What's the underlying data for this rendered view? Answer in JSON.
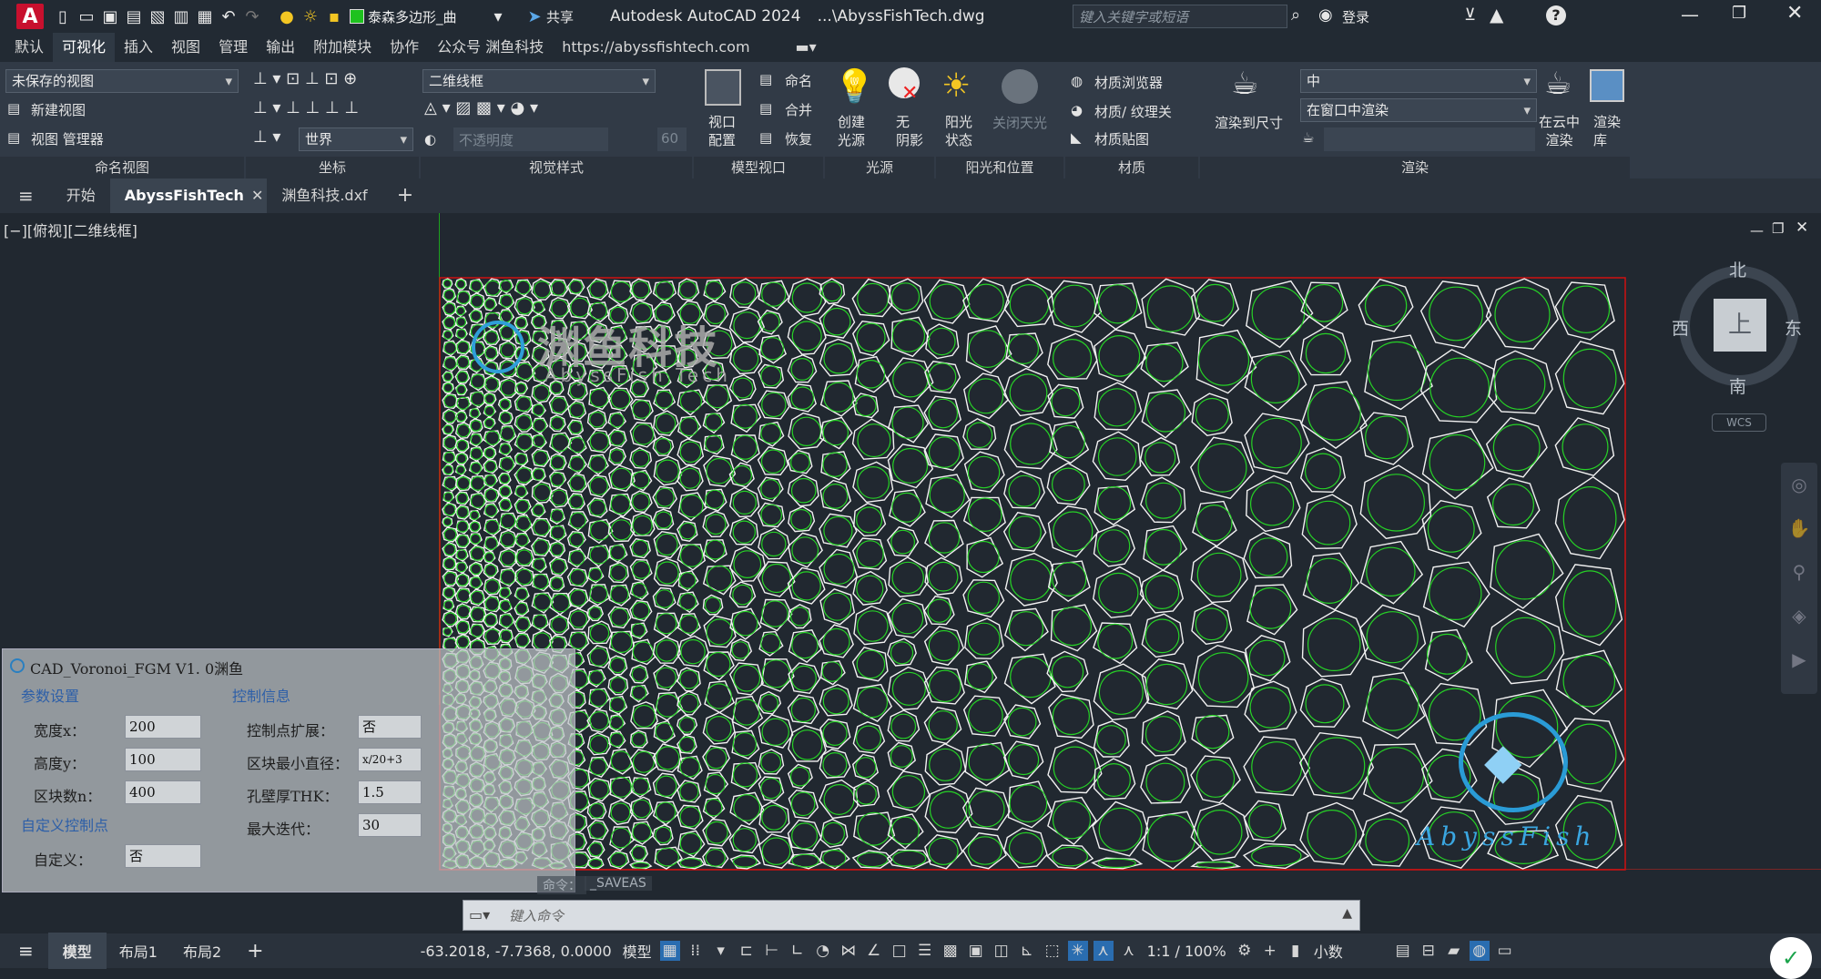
{
  "title": {
    "app_name": "Autodesk AutoCAD 2024",
    "file": "...\\AbyssFishTech.dwg",
    "layer": "泰森多边形_曲",
    "share": "共享",
    "search_placeholder": "键入关键字或短语",
    "login": "登录"
  },
  "menu": [
    "默认",
    "可视化",
    "插入",
    "视图",
    "管理",
    "输出",
    "附加模块",
    "协作",
    "公众号 渊鱼科技",
    "https://abyssfishtech.com"
  ],
  "ribbon": {
    "named_views": {
      "dropdown": "未保存的视图",
      "new_view": "新建视图",
      "view_manager": "视图 管理器",
      "panel": "命名视图"
    },
    "coords": {
      "ucs": "世界",
      "panel": "坐标"
    },
    "visual_styles": {
      "style": "二维线框",
      "opacity": "不透明度",
      "opacity_value": "60",
      "panel": "视觉样式"
    },
    "model_viewports": {
      "config": "视口\n配置",
      "named": "命名",
      "join": "合并",
      "restore": "恢复",
      "panel": "模型视口"
    },
    "lights": {
      "create": "创建\n光源",
      "no_shadow": "无\n阴影",
      "panel": "光源"
    },
    "sun": {
      "state": "阳光\n状态",
      "sky_off": "关闭天光",
      "panel": "阳光和位置"
    },
    "materials": {
      "browser": "材质浏览器",
      "texture": "材质/ 纹理关",
      "mapping": "材质贴图",
      "panel": "材质"
    },
    "render": {
      "render_size": "渲染到尺寸",
      "quality": "中",
      "target": "在窗口中渲染",
      "cloud": "在云中\n渲染",
      "gallery": "渲染\n库",
      "panel": "渲染"
    }
  },
  "tabs": [
    "开始",
    "AbyssFishTech",
    "渊鱼科技.dxf"
  ],
  "viewport": {
    "label": "[−][俯视][二维线框]",
    "watermark_cn": "渊鱼科技",
    "watermark_en": "AbyssFish Tech",
    "logo_text": "AbyssFish"
  },
  "viewcube": {
    "north": "北",
    "south": "南",
    "east": "东",
    "west": "西",
    "top": "上",
    "wcs": "WCS"
  },
  "dialog": {
    "title": "CAD_Voronoi_FGM V1. 0渊鱼",
    "section_params": "参数设置",
    "section_control": "控制信息",
    "section_custom": "自定义控制点",
    "width_label": "宽度x：",
    "width": "200",
    "height_label": "高度y：",
    "height": "100",
    "blocks_label": "区块数n：",
    "blocks": "400",
    "custom_label": "自定义：",
    "custom": "否",
    "extend_label": "控制点扩展：",
    "extend": "否",
    "mindia_label": "区块最小直径：",
    "mindia": "x/20+3",
    "thk_label": "孔壁厚THK：",
    "thk": "1.5",
    "iter_label": "最大迭代：",
    "iter": "30"
  },
  "command": {
    "history_label": "命令：",
    "history": "_SAVEAS",
    "placeholder": "键入命令"
  },
  "status": {
    "model_tab": "模型",
    "layout1": "布局1",
    "layout2": "布局2",
    "coords": "-63.2018, -7.7368, 0.0000",
    "space": "模型",
    "scale": "1:1 / 100%",
    "units": "小数"
  }
}
